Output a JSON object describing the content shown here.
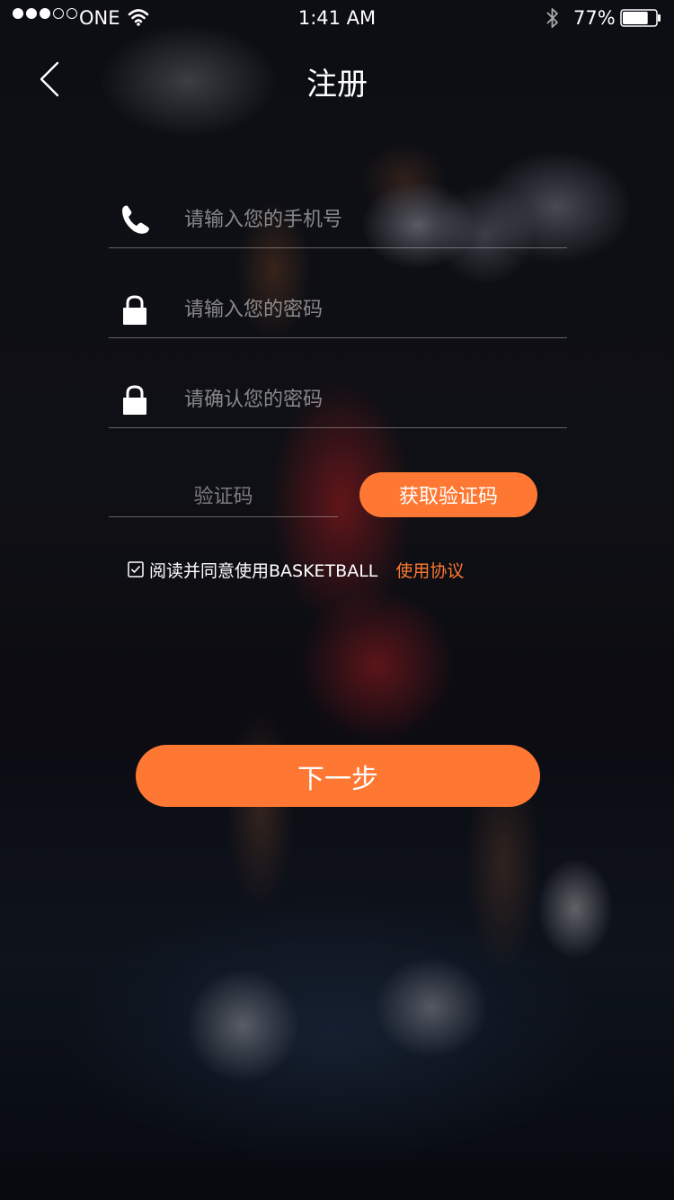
{
  "status_bar": {
    "carrier": "ONE",
    "time": "1:41 AM",
    "battery": "77%",
    "battery_level": 0.77,
    "signal_full_dots": 3,
    "signal_total_dots": 5
  },
  "nav": {
    "title": "注册",
    "back_icon": "chevron-left-icon"
  },
  "form": {
    "phone_placeholder": "请输入您的手机号",
    "phone_icon": "phone-icon",
    "password_placeholder": "请输入您的密码",
    "password_icon": "lock-icon",
    "confirm_placeholder": "请确认您的密码",
    "confirm_icon": "lock-icon",
    "code_placeholder": "验证码",
    "get_code_label": "获取验证码"
  },
  "agreement": {
    "checked": true,
    "text": "阅读并同意使用BASKETBALL",
    "link": "使用协议"
  },
  "next_button": "下一步",
  "colors": {
    "accent": "#fe7833",
    "text": "#ffffff",
    "placeholder": "rgba(255,255,255,0.5)"
  }
}
